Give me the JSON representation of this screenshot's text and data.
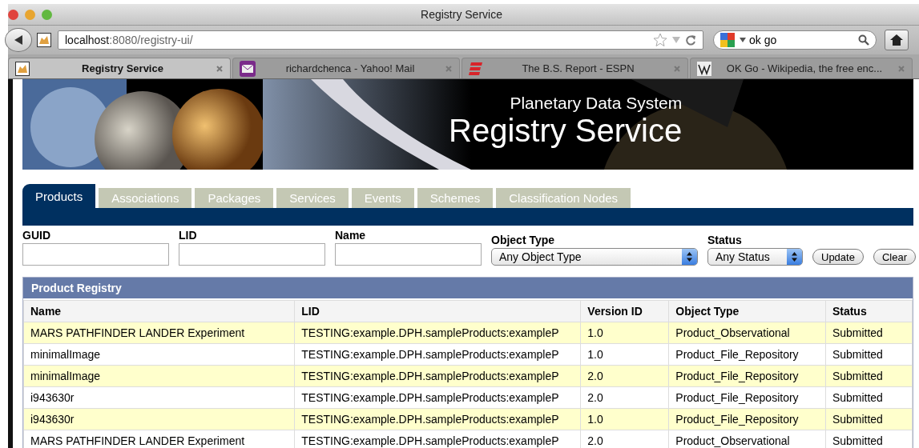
{
  "window": {
    "title": "Registry Service"
  },
  "toolbar": {
    "url": {
      "host": "localhost",
      "path": ":8080/registry-ui/"
    },
    "search": {
      "value": "ok go"
    }
  },
  "browser_tabs": [
    {
      "title": "Registry Service",
      "selected": true,
      "kind": "page"
    },
    {
      "title": "richardchenca - Yahoo! Mail",
      "selected": false,
      "kind": "mail"
    },
    {
      "title": "The B.S. Report - ESPN",
      "selected": false,
      "kind": "sport"
    },
    {
      "title": "OK Go - Wikipedia, the free enc...",
      "selected": false,
      "kind": "wiki"
    }
  ],
  "banner": {
    "subtitle": "Planetary Data System",
    "title": "Registry Service"
  },
  "nav_tabs": [
    {
      "label": "Products",
      "selected": true
    },
    {
      "label": "Associations",
      "selected": false
    },
    {
      "label": "Packages",
      "selected": false
    },
    {
      "label": "Services",
      "selected": false
    },
    {
      "label": "Events",
      "selected": false
    },
    {
      "label": "Schemes",
      "selected": false
    },
    {
      "label": "Classification Nodes",
      "selected": false
    }
  ],
  "filters": [
    {
      "label": "GUID",
      "kind": "text"
    },
    {
      "label": "LID",
      "kind": "text"
    },
    {
      "label": "Name",
      "kind": "text"
    },
    {
      "label": "Object Type",
      "kind": "select",
      "value": "Any Object Type"
    },
    {
      "label": "Status",
      "kind": "select",
      "value": "Any Status"
    }
  ],
  "buttons": [
    "Update",
    "Clear"
  ],
  "table": {
    "title": "Product Registry",
    "columns": [
      "Name",
      "LID",
      "Version ID",
      "Object Type",
      "Status"
    ],
    "rows": [
      {
        "highlighted": true,
        "cells": [
          "MARS PATHFINDER LANDER Experiment",
          "TESTING:example.DPH.sampleProducts:exampleP",
          "1.0",
          "Product_Observational",
          "Submitted"
        ]
      },
      {
        "highlighted": false,
        "cells": [
          "minimalImage",
          "TESTING:example.DPH.sampleProducts:exampleP",
          "1.0",
          "Product_File_Repository",
          "Submitted"
        ]
      },
      {
        "highlighted": true,
        "cells": [
          "minimalImage",
          "TESTING:example.DPH.sampleProducts:exampleP",
          "2.0",
          "Product_File_Repository",
          "Submitted"
        ]
      },
      {
        "highlighted": false,
        "cells": [
          "i943630r",
          "TESTING:example.DPH.sampleProducts:exampleP",
          "2.0",
          "Product_File_Repository",
          "Submitted"
        ]
      },
      {
        "highlighted": true,
        "cells": [
          "i943630r",
          "TESTING:example.DPH.sampleProducts:exampleP",
          "1.0",
          "Product_File_Repository",
          "Submitted"
        ]
      },
      {
        "highlighted": false,
        "cells": [
          "MARS PATHFINDER LANDER Experiment",
          "TESTING:example.DPH.sampleProducts:exampleP",
          "2.0",
          "Product_Observational",
          "Submitted"
        ]
      }
    ]
  }
}
